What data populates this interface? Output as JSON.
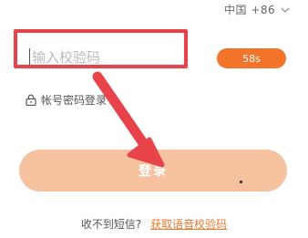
{
  "region": {
    "label": "中国 +86",
    "icon": "chevron-down-icon"
  },
  "code_input": {
    "placeholder": "请输入校验码",
    "visible_text": "输入校验码"
  },
  "sms_button": {
    "label": "58s"
  },
  "password_login": {
    "label": "帐号密码登录",
    "icon": "lock-icon"
  },
  "login_button": {
    "label": "登录"
  },
  "footer": {
    "question": "收不到短信?",
    "voice_link": "获取语音校验码"
  },
  "annotation": {
    "color": "#e8434a"
  },
  "colors": {
    "accent": "#f3742b",
    "login_button": "#f5c19f",
    "link": "#e87a2f"
  }
}
